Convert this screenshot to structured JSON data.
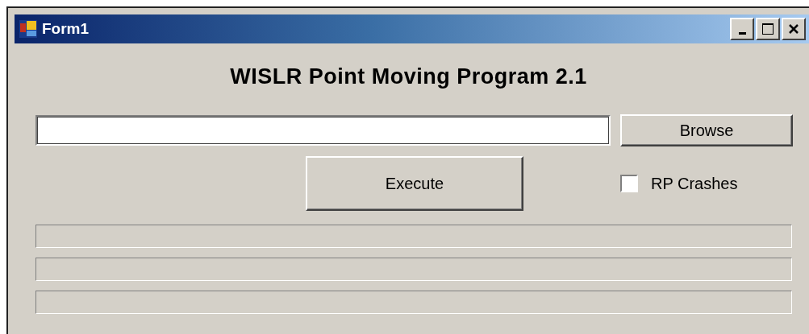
{
  "window": {
    "title": "Form1"
  },
  "heading": "WISLR Point Moving Program 2.1",
  "browse_button": "Browse",
  "execute_button": "Execute",
  "rp_crashes": {
    "label": "RP Crashes",
    "checked": false
  },
  "progress_bars": [
    {
      "level": 0
    },
    {
      "level": 0
    },
    {
      "level": 0
    }
  ]
}
